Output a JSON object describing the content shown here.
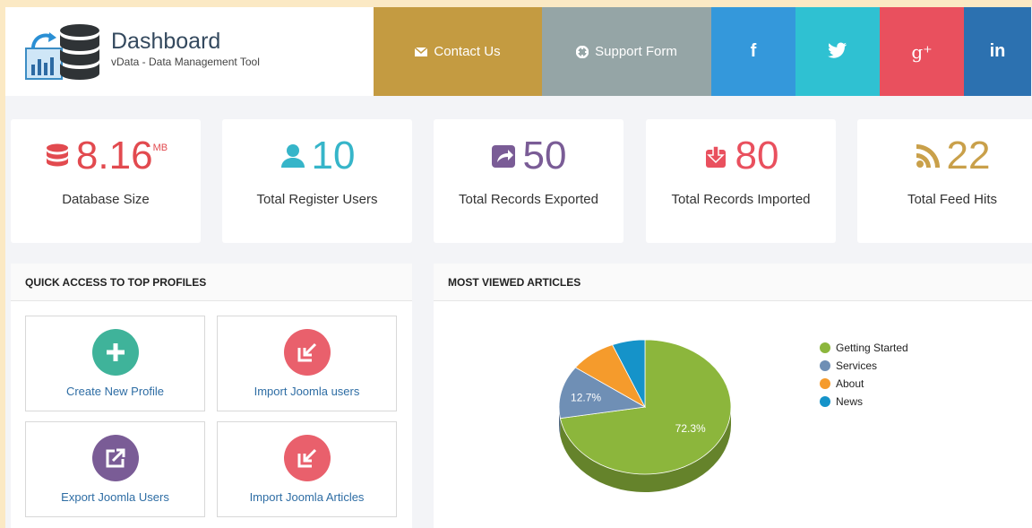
{
  "header": {
    "title": "Dashboard",
    "subtitle": "vData - Data Management Tool",
    "contact_label": "Contact Us",
    "support_label": "Support Form",
    "facebook_label": "f",
    "googleplus_label": "g⁺",
    "linkedin_label": "in"
  },
  "colors": {
    "contact": "#c49b41",
    "support": "#95a5a6",
    "facebook": "#3498db",
    "twitter": "#2fc1d2",
    "googleplus": "#e9505e",
    "linkedin": "#2c71b0",
    "db": "#e24a4f",
    "users": "#36b5c9",
    "export": "#7a5c96",
    "import": "#e9505e",
    "feed": "#c9a04a"
  },
  "stats": [
    {
      "value": "8.16",
      "unit": "MB",
      "label": "Database Size",
      "icon": "database-icon"
    },
    {
      "value": "10",
      "unit": "",
      "label": "Total Register Users",
      "icon": "user-icon"
    },
    {
      "value": "50",
      "unit": "",
      "label": "Total Records Exported",
      "icon": "share-icon"
    },
    {
      "value": "80",
      "unit": "",
      "label": "Total Records Imported",
      "icon": "import-icon"
    },
    {
      "value": "22",
      "unit": "",
      "label": "Total Feed Hits",
      "icon": "rss-icon"
    }
  ],
  "quick_access": {
    "title": "QUICK ACCESS TO TOP PROFILES",
    "items": [
      {
        "label": "Create New Profile",
        "icon": "plus-icon",
        "color": "#3fb39a"
      },
      {
        "label": "Import Joomla users",
        "icon": "import-icon",
        "color": "#e9606c"
      },
      {
        "label": "Export Joomla Users",
        "icon": "export-icon",
        "color": "#7a5c96"
      },
      {
        "label": "Import Joomla Articles",
        "icon": "import-icon",
        "color": "#e9606c"
      }
    ]
  },
  "articles": {
    "title": "MOST VIEWED ARTICLES"
  },
  "chart_data": {
    "type": "pie",
    "title": "",
    "series": [
      {
        "name": "Getting Started",
        "value": 72.3,
        "color": "#8cb63c"
      },
      {
        "name": "Services",
        "value": 12.7,
        "color": "#6f8fb5"
      },
      {
        "name": "About",
        "value": 8.8,
        "color": "#f59b2c"
      },
      {
        "name": "News",
        "value": 6.2,
        "color": "#1593c9"
      }
    ],
    "data_labels": [
      "72.3%",
      "12.7%"
    ],
    "legend_position": "right"
  }
}
